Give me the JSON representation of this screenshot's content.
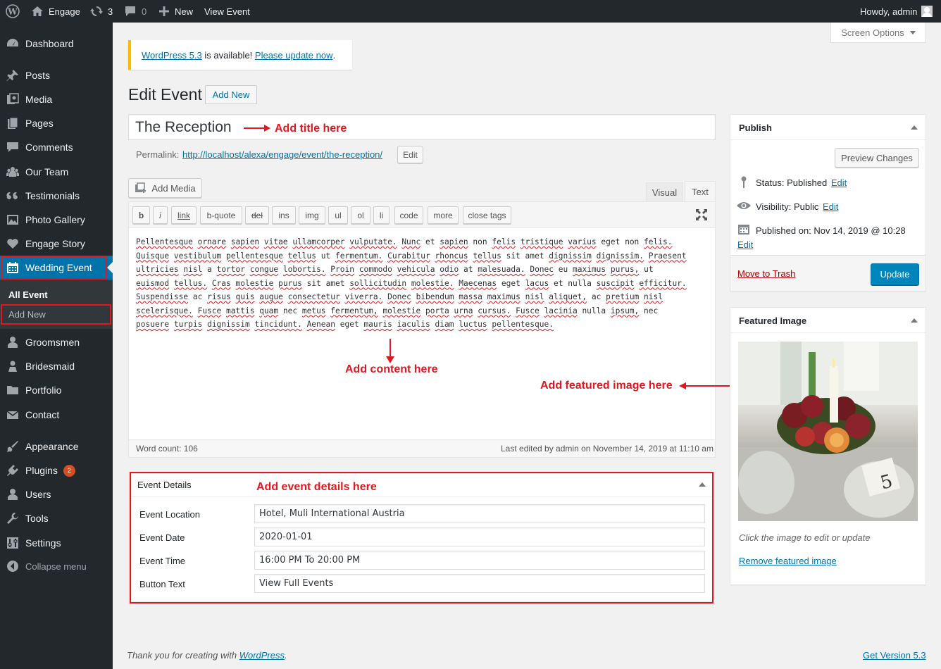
{
  "adminbar": {
    "site_name": "Engage",
    "updates_count": "3",
    "comments_count": "0",
    "new_label": "New",
    "view_label": "View Event",
    "howdy": "Howdy, admin"
  },
  "sidebar": {
    "items": [
      {
        "label": "Dashboard"
      },
      {
        "label": "Posts"
      },
      {
        "label": "Media"
      },
      {
        "label": "Pages"
      },
      {
        "label": "Comments"
      },
      {
        "label": "Our Team"
      },
      {
        "label": "Testimonials"
      },
      {
        "label": "Photo Gallery"
      },
      {
        "label": "Engage Story"
      },
      {
        "label": "Wedding Event"
      },
      {
        "label": "Groomsmen"
      },
      {
        "label": "Bridesmaid"
      },
      {
        "label": "Portfolio"
      },
      {
        "label": "Contact"
      },
      {
        "label": "Appearance"
      },
      {
        "label": "Plugins"
      },
      {
        "label": "Users"
      },
      {
        "label": "Tools"
      },
      {
        "label": "Settings"
      },
      {
        "label": "Collapse menu"
      }
    ],
    "submenu": [
      "All Event",
      "Add New"
    ],
    "plugins_badge": "2"
  },
  "screen_options": "Screen Options",
  "notice": {
    "link1": "WordPress 5.3",
    "text": " is available! ",
    "link2": "Please update now",
    "end": "."
  },
  "page": {
    "title": "Edit Event",
    "add_new": "Add New"
  },
  "post": {
    "title": "The Reception",
    "permalink_label": "Permalink:",
    "permalink_url": "http://localhost/alexa/engage/event/the-reception/",
    "permalink_edit": "Edit"
  },
  "editor": {
    "add_media": "Add Media",
    "tab_visual": "Visual",
    "tab_text": "Text",
    "quicktags": [
      "b",
      "i",
      "link",
      "b-quote",
      "del",
      "ins",
      "img",
      "ul",
      "ol",
      "li",
      "code",
      "more",
      "close tags"
    ],
    "content_lines": [
      "Pellentesque ornare sapien vitae ullamcorper vulputate. Nunc et sapien non felis tristique varius eget non felis.",
      "Quisque vestibulum pellentesque tellus ut fermentum. Curabitur rhoncus tellus sit amet dignissim dignissim. Praesent",
      "ultricies nisl a tortor congue lobortis. Proin commodo vehicula odio at malesuada. Donec eu maximus purus, ut",
      "euismod tellus. Cras molestie purus sit amet sollicitudin molestie. Maecenas eget lacus et nulla suscipit efficitur.",
      "Suspendisse ac risus quis augue consectetur viverra. Donec bibendum massa maximus nisl aliquet, ac pretium nisl",
      "scelerisque. Fusce mattis quam nec metus fermentum, molestie porta urna cursus. Fusce lacinia nulla ipsum, nec",
      "posuere turpis dignissim tincidunt. Aenean eget mauris iaculis diam luctus pellentesque."
    ],
    "word_count": "Word count: 106",
    "last_edited": "Last edited by admin on November 14, 2019 at 11:10 am"
  },
  "annotations": {
    "title": "Add title here",
    "content": "Add content here",
    "featured": "Add featured image here",
    "details": "Add event details here"
  },
  "event_details": {
    "heading": "Event Details",
    "fields": [
      {
        "label": "Event Location",
        "value": "Hotel, Muli International Austria"
      },
      {
        "label": "Event Date",
        "value": "2020-01-01"
      },
      {
        "label": "Event Time",
        "value": "16:00 PM To 20:00 PM"
      },
      {
        "label": "Button Text",
        "value": "View Full Events"
      }
    ]
  },
  "publish": {
    "heading": "Publish",
    "preview": "Preview Changes",
    "status_label": "Status: ",
    "status_value": "Published",
    "visibility_label": "Visibility: ",
    "visibility_value": "Public",
    "published_label": "Published on: ",
    "published_value": "Nov 14, 2019 @ 10:28",
    "edit": "Edit",
    "trash": "Move to Trash",
    "update": "Update"
  },
  "featured_image": {
    "heading": "Featured Image",
    "hint": "Click the image to edit or update",
    "remove": "Remove featured image"
  },
  "footer": {
    "thanks": "Thank you for creating with ",
    "wp_link": "WordPress",
    "dot": ".",
    "version": "Get Version 5.3"
  },
  "colors": {
    "admin_bg": "#23282d",
    "accent": "#0073aa",
    "annotation_red": "#e0181f"
  }
}
